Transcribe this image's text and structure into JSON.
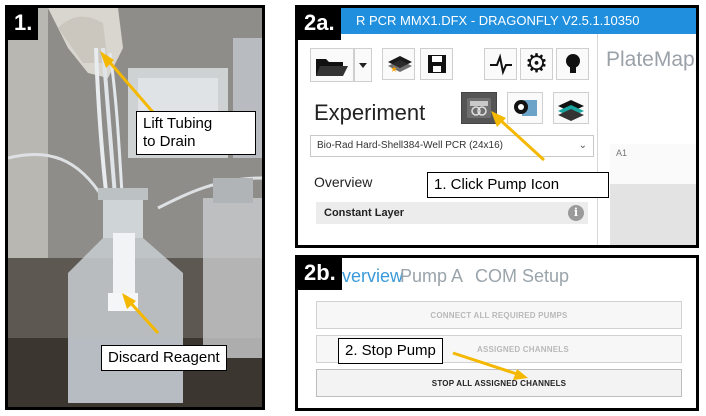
{
  "panel1": {
    "step": "1.",
    "callout_lift_line1": "Lift Tubing",
    "callout_lift_line2": "to Drain",
    "callout_discard": "Discard Reagent"
  },
  "panel2a": {
    "step": "2a.",
    "window_title": "R PCR MMX1.DFX - DRAGONFLY V2.5.1.10350",
    "plate_map_label": "PlateMap",
    "experiment_title": "Experiment",
    "plate_select_value": "Bio-Rad Hard-Shell384-Well PCR  (24x16)",
    "overview_label": "Overview",
    "constant_layer_label": "Constant Layer",
    "well_label": "A1",
    "callout": "1. Click Pump Icon",
    "icons": [
      "folder-open-icon",
      "dropdown-arrow-icon",
      "stack-star-icon",
      "save-icon",
      "pulse-icon",
      "gear-icon",
      "lightbulb-icon",
      "pump-icon",
      "gear-plate-icon",
      "layers-icon",
      "info-icon"
    ]
  },
  "panel2b": {
    "step": "2b.",
    "tabs": [
      "verview",
      "Pump A",
      "COM Setup"
    ],
    "buttons": [
      "CONNECT ALL REQUIRED PUMPS",
      "ASSIGNED CHANNELS",
      "STOP ALL ASSIGNED CHANNELS"
    ],
    "callout": "2. Stop Pump"
  },
  "colors": {
    "titlebar": "#1f8fde",
    "arrow": "#f5b800",
    "active_tab": "#3a9ad9"
  }
}
